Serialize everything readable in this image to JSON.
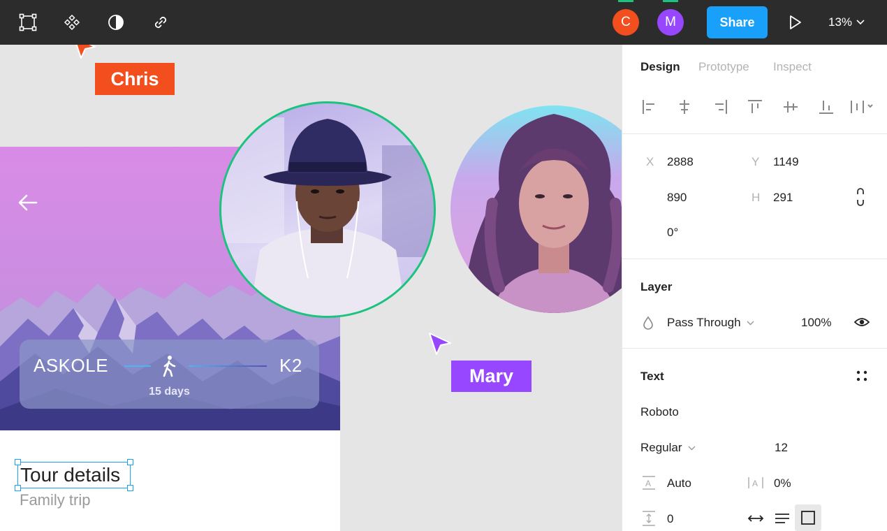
{
  "toolbar": {
    "tools": [
      {
        "name": "frame-tool",
        "icon": "frame-icon"
      },
      {
        "name": "component-tool",
        "icon": "component-icon"
      },
      {
        "name": "contrast-tool",
        "icon": "contrast-icon"
      },
      {
        "name": "link-tool",
        "icon": "link-icon"
      }
    ],
    "collaborators": [
      {
        "initial": "C",
        "color": "#f24e1e"
      },
      {
        "initial": "M",
        "color": "#9747ff"
      }
    ],
    "share_label": "Share",
    "zoom": "13%"
  },
  "canvas": {
    "route": {
      "from": "ASKOLE",
      "to": "K2",
      "duration": "15 days"
    },
    "tour_title": "Tour details",
    "tour_subtitle": "Family trip",
    "cursors": [
      {
        "name": "Chris",
        "color": "#f24e1e"
      },
      {
        "name": "Mary",
        "color": "#9747ff"
      }
    ]
  },
  "panel": {
    "tabs": [
      "Design",
      "Prototype",
      "Inspect"
    ],
    "active_tab": "Design",
    "x_label": "X",
    "x_value": "2888",
    "y_label": "Y",
    "y_value": "1149",
    "w_value": "890",
    "h_label": "H",
    "h_value": "291",
    "rotation": "0°",
    "layer": {
      "title": "Layer",
      "blend_mode": "Pass Through",
      "opacity": "100%"
    },
    "text": {
      "title": "Text",
      "font_family": "Roboto",
      "font_weight": "Regular",
      "font_size": "12",
      "line_height": "Auto",
      "letter_spacing": "0%",
      "paragraph_spacing": "0"
    }
  },
  "colors": {
    "accent": "#18a0fb",
    "selection": "#1bc47d",
    "chris": "#f24e1e",
    "mary": "#9747ff"
  }
}
